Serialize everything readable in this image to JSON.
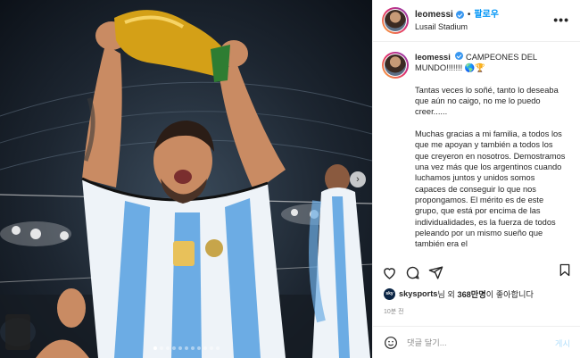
{
  "header": {
    "username": "leomessi",
    "separator": "•",
    "follow_label": "팔로우",
    "location": "Lusail Stadium",
    "more_label": "•••"
  },
  "caption": {
    "username": "leomessi",
    "headline": "CAMPEONES DEL MUNDO!!!!!!! 🌎🏆",
    "paragraphs": [
      "Tantas veces lo soñé, tanto lo deseaba que aún no caigo, no me lo puedo creer......",
      "Muchas gracias a mi familia, a todos los que me apoyan y también a todos los que creyeron en nosotros. Demostramos una vez más que los argentinos cuando luchamos juntos y unidos somos capaces de conseguir lo que nos propongamos. El mérito es de este grupo, que está por encima de las individualidades, es la fuerza de todos peleando por un mismo sueño que también era el"
    ]
  },
  "likes": {
    "avatar_text": "sky",
    "liker": "skysports",
    "middle": "님 외",
    "count": "368만명",
    "suffix": "이 좋아합니다"
  },
  "time_ago": "10분 전",
  "comment": {
    "placeholder": "댓글 달기...",
    "post_label": "게시"
  },
  "carousel": {
    "dot_count": 11,
    "active_index": 0,
    "next_label": "›"
  },
  "colors": {
    "accent": "#0095f6",
    "verified": "#3897f0",
    "post_disabled": "#b2dffc",
    "jersey_blue": "#6cace4"
  },
  "icons": [
    "heart-icon",
    "comment-icon",
    "share-icon",
    "bookmark-icon",
    "emoji-icon",
    "more-icon",
    "verified-icon"
  ]
}
